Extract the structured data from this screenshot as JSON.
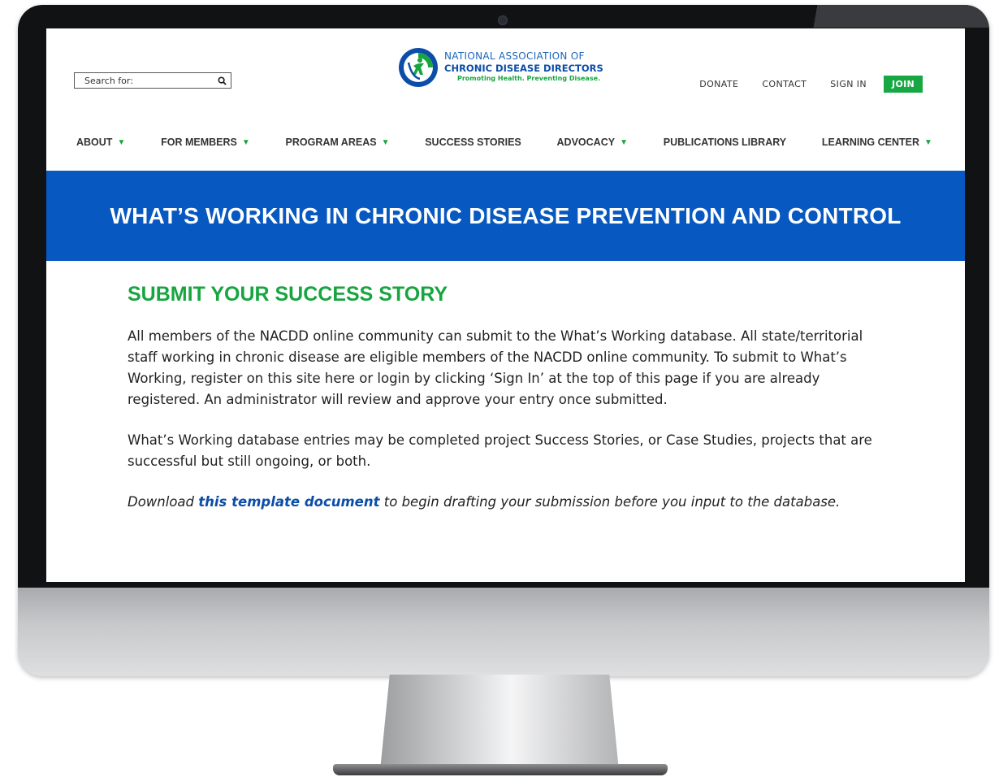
{
  "colors": {
    "banner": "#0758c0",
    "accent_green": "#17a53f",
    "link_blue": "#0b4da8",
    "join_button": "#18a843"
  },
  "search": {
    "placeholder": "Search for:",
    "icon": "search-icon"
  },
  "logo": {
    "line1": "NATIONAL ASSOCIATION OF",
    "line2": "CHRONIC DISEASE DIRECTORS",
    "tagline": "Promoting Health. Preventing Disease."
  },
  "top_links": {
    "donate": "DONATE",
    "contact": "CONTACT",
    "sign_in": "SIGN IN",
    "join": "JOIN"
  },
  "nav": [
    {
      "label": "ABOUT",
      "caret": "▼"
    },
    {
      "label": "FOR MEMBERS",
      "caret": "▼"
    },
    {
      "label": "PROGRAM AREAS",
      "caret": "▼"
    },
    {
      "label": "SUCCESS STORIES",
      "caret": ""
    },
    {
      "label": "ADVOCACY",
      "caret": "▼"
    },
    {
      "label": "PUBLICATIONS LIBRARY",
      "caret": ""
    },
    {
      "label": "LEARNING CENTER",
      "caret": "▼"
    }
  ],
  "banner": {
    "title": "WHAT’S WORKING IN CHRONIC DISEASE PREVENTION AND CONTROL"
  },
  "content": {
    "heading": "SUBMIT YOUR SUCCESS STORY",
    "paragraph1": "All members of the NACDD online community can submit to the What’s Working database. All state/territorial staff working in chronic disease are eligible members of the NACDD online community. To submit to What’s Working, register on this site here or login by clicking ‘Sign In’ at the top of this page if you are already registered. An administrator will review and approve your entry once submitted.",
    "paragraph2": "What’s Working database entries may be completed project Success Stories, or Case Studies, projects that are successful but still ongoing, or both.",
    "paragraph3_before": "Download ",
    "paragraph3_link": "this template document",
    "paragraph3_after": " to begin drafting your submission before you input to the database."
  }
}
